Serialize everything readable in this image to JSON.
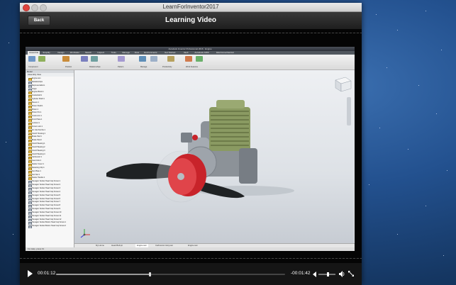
{
  "window": {
    "title": "LearnForInventor2017"
  },
  "nav": {
    "back_label": "Back",
    "page_title": "Learning Video"
  },
  "inventor": {
    "title": "Autodesk Inventor Professional 2016 · Engine",
    "tabs": [
      "Assemble",
      "Simplify",
      "Design",
      "3D Model",
      "Sketch",
      "Inspect",
      "Tools",
      "Manage",
      "View",
      "Environments",
      "Get Started",
      "Vault",
      "Autodesk A360",
      "Electromechanical"
    ],
    "ribbon_groups": [
      "Component",
      "Position",
      "Relationships",
      "Pattern",
      "Manage",
      "Productivity",
      "Work Features"
    ],
    "browser_header": "Model",
    "browser_filter": "Assembly View",
    "tree": [
      {
        "name": "Engine.iam",
        "type": "root"
      },
      {
        "name": "Relationships",
        "type": "a"
      },
      {
        "name": "Representations",
        "type": "a"
      },
      {
        "name": "Origin",
        "type": "a"
      },
      {
        "name": "Engine Block:1",
        "type": "p"
      },
      {
        "name": "Crankshaft:1",
        "type": "p"
      },
      {
        "name": "Cylinder Shaft:1",
        "type": "p"
      },
      {
        "name": "Sleeve:1",
        "type": "p"
      },
      {
        "name": "Piston Shaft:1",
        "type": "p"
      },
      {
        "name": "Piston:1",
        "type": "p"
      },
      {
        "name": "Piston Pin:1",
        "type": "p"
      },
      {
        "name": "Crank Arm:1",
        "type": "p"
      },
      {
        "name": "Front Plate:1",
        "type": "p"
      },
      {
        "name": "Locknut:1",
        "type": "p"
      },
      {
        "name": "Screw Lock:1",
        "type": "p"
      },
      {
        "name": "Air Inlet Nozzle:1",
        "type": "p"
      },
      {
        "name": "Clutch Housing:1",
        "type": "p"
      },
      {
        "name": "Brake Pad:1",
        "type": "p"
      },
      {
        "name": "Brake Pad:2",
        "type": "p"
      },
      {
        "name": "Clutch Bearing:1",
        "type": "p"
      },
      {
        "name": "Clutch Bearing:2",
        "type": "p"
      },
      {
        "name": "Clutch Bearing:3",
        "type": "p"
      },
      {
        "name": "Clutch Bearing:4",
        "type": "p"
      },
      {
        "name": "Carburetor:1",
        "type": "p"
      },
      {
        "name": "Gear Axle:1",
        "type": "p"
      },
      {
        "name": "Starter Cover:1",
        "type": "p"
      },
      {
        "name": "Retaining Clip:1",
        "type": "p"
      },
      {
        "name": "Fan Plate:1",
        "type": "p"
      },
      {
        "name": "Fan Nut:1",
        "type": "p"
      },
      {
        "name": "Starter Handle:1",
        "type": "p"
      },
      {
        "name": "Hexagon Socket Head Cap Screw:1",
        "type": "a"
      },
      {
        "name": "Hexagon Socket Head Cap Screw:2",
        "type": "a"
      },
      {
        "name": "Hexagon Socket Head Cap Screw:3",
        "type": "a"
      },
      {
        "name": "Hexagon Socket Head Cap Screw:4",
        "type": "a"
      },
      {
        "name": "Hexagon Socket Head Cap Screw:5",
        "type": "a"
      },
      {
        "name": "Hexagon Socket Head Cap Screw:6",
        "type": "a"
      },
      {
        "name": "Hexagon Socket Head Cap Screw:7",
        "type": "a"
      },
      {
        "name": "Hexagon Socket Head Cap Screw:8",
        "type": "a"
      },
      {
        "name": "Hexagon Socket Head Cap Screw:9",
        "type": "a"
      },
      {
        "name": "Hexagon Socket Head Cap Screw:10",
        "type": "a"
      },
      {
        "name": "Hexagon Socket Head Cap Screw:11",
        "type": "a"
      },
      {
        "name": "Hexagon Socket Head Cap Screw:12",
        "type": "a"
      },
      {
        "name": "Hexagon Socket Button Head Cap Screw:1",
        "type": "a"
      },
      {
        "name": "Hexagon Socket Button Head Cap Screw:2",
        "type": "a"
      }
    ],
    "doc_tabs": [
      "My Home",
      "Head Bolt.ipt",
      "Engine.iam",
      "Carburetor Assy.iam",
      "Engine.iam"
    ],
    "status": "For Help, press F1"
  },
  "player": {
    "elapsed": "00:01:12",
    "remaining": "-00:01:42",
    "progress": 0.41,
    "volume": 0.55
  },
  "colors": {
    "accent_red": "#e0443e",
    "propeller_hub": "#c8232a",
    "cylinder_green": "#8a9a62"
  }
}
